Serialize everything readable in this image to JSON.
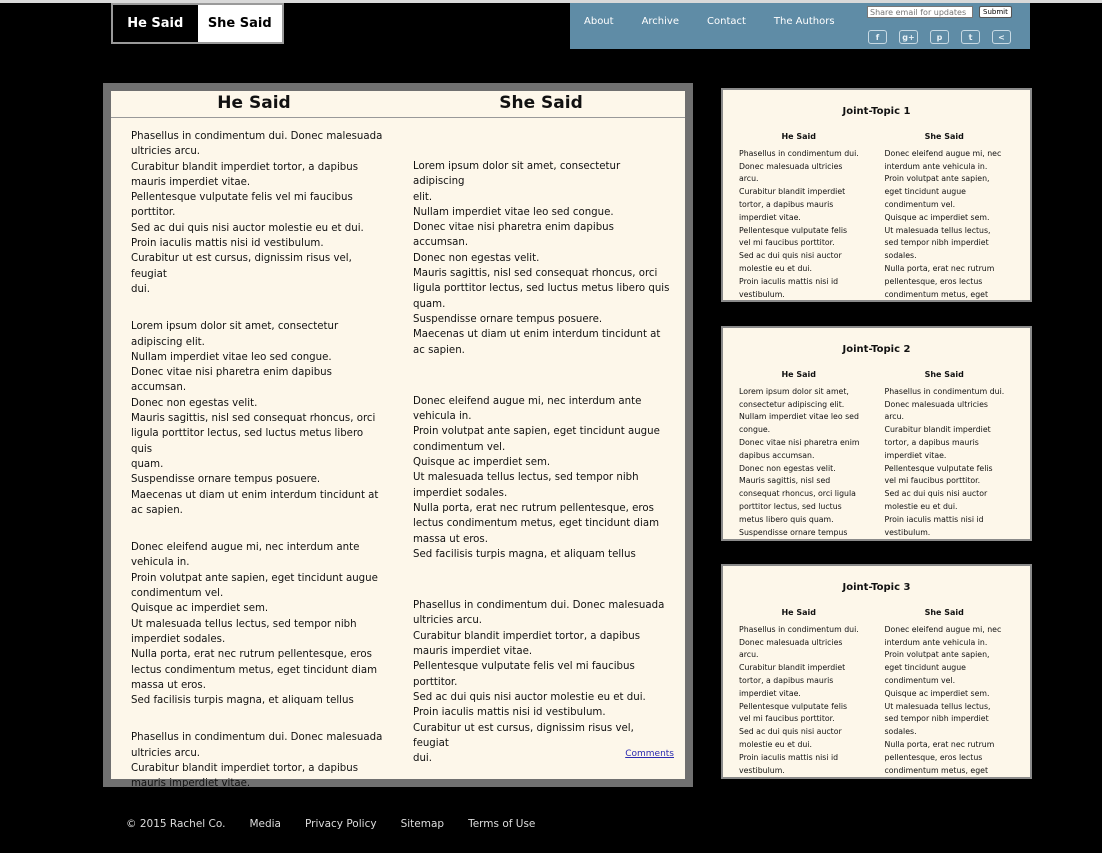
{
  "logo": {
    "he": "He Said",
    "she": "She Said"
  },
  "nav": {
    "links": [
      "About",
      "Archive",
      "Contact",
      "The Authors"
    ],
    "email_placeholder": "Share email for updates",
    "submit_label": "Submit",
    "social_icons": [
      "facebook-icon",
      "google-plus-icon",
      "pinterest-icon",
      "twitter-icon",
      "share-icon"
    ],
    "social_glyphs": [
      "f",
      "g+",
      "p",
      "t",
      "<"
    ]
  },
  "main": {
    "he_title": "He Said",
    "she_title": "She Said",
    "he_paragraphs": [
      [
        "Phasellus in condimentum dui. Donec malesuada",
        "ultricies arcu.",
        "Curabitur blandit imperdiet tortor, a dapibus",
        "mauris imperdiet vitae.",
        "Pellentesque vulputate felis vel mi faucibus",
        "porttitor.",
        "Sed ac dui quis nisi auctor molestie eu et dui.",
        "Proin iaculis mattis nisi id vestibulum.",
        "Curabitur ut est cursus, dignissim risus vel, feugiat",
        "dui."
      ],
      [
        "Lorem ipsum dolor sit amet, consectetur",
        "adipiscing elit.",
        "Nullam imperdiet vitae leo sed congue.",
        "Donec vitae nisi pharetra enim dapibus accumsan.",
        "Donec non egestas velit.",
        "Mauris sagittis, nisl sed consequat rhoncus, orci",
        "ligula porttitor lectus, sed luctus metus libero quis",
        "quam.",
        "Suspendisse ornare tempus posuere.",
        "Maecenas ut diam ut enim interdum tincidunt at",
        "ac sapien."
      ],
      [
        "Donec eleifend augue mi, nec interdum ante",
        "vehicula in.",
        "Proin volutpat ante sapien, eget tincidunt augue",
        "condimentum vel.",
        "Quisque ac imperdiet sem.",
        "Ut malesuada tellus lectus, sed tempor nibh",
        "imperdiet sodales.",
        "Nulla porta, erat nec rutrum pellentesque, eros",
        "lectus condimentum metus, eget tincidunt diam",
        "massa ut eros.",
        "Sed facilisis turpis magna, et aliquam tellus"
      ],
      [
        "Phasellus in condimentum dui. Donec malesuada",
        "ultricies arcu.",
        "Curabitur blandit imperdiet tortor, a dapibus",
        "mauris imperdiet vitae."
      ]
    ],
    "she_paragraphs": [
      [
        "Lorem ipsum dolor sit amet, consectetur adipiscing",
        "elit.",
        "Nullam imperdiet vitae leo sed congue.",
        "Donec vitae nisi pharetra enim dapibus accumsan.",
        "Donec non egestas velit.",
        "Mauris sagittis, nisl sed consequat rhoncus, orci",
        "ligula porttitor lectus, sed luctus metus libero quis",
        "quam.",
        "Suspendisse ornare tempus posuere.",
        "Maecenas ut diam ut enim interdum tincidunt at",
        "ac sapien."
      ],
      [
        "Donec eleifend augue mi, nec interdum ante",
        "vehicula in.",
        "Proin volutpat ante sapien, eget tincidunt augue",
        "condimentum vel.",
        "Quisque ac imperdiet sem.",
        "Ut malesuada tellus lectus, sed tempor nibh",
        "imperdiet sodales.",
        "Nulla porta, erat nec rutrum pellentesque, eros",
        "lectus condimentum metus, eget tincidunt diam",
        "massa ut eros.",
        "Sed facilisis turpis magna, et aliquam tellus"
      ],
      [
        "Phasellus in condimentum dui. Donec malesuada",
        "ultricies arcu.",
        "Curabitur blandit imperdiet tortor, a dapibus",
        "mauris imperdiet vitae.",
        "Pellentesque vulputate felis vel mi faucibus",
        "porttitor.",
        "Sed ac dui quis nisi auctor molestie eu et dui.",
        "Proin iaculis mattis nisi id vestibulum.",
        "Curabitur ut est cursus, dignissim risus vel, feugiat",
        "dui."
      ]
    ],
    "comments_label": "Comments"
  },
  "cards": [
    {
      "title": "Joint-Topic 1",
      "he_label": "He Said",
      "she_label": "She Said",
      "he_lines": [
        "Phasellus in condimentum dui.",
        "Donec malesuada ultricies",
        "arcu.",
        "Curabitur blandit imperdiet",
        "tortor, a dapibus mauris",
        "imperdiet vitae.",
        "Pellentesque vulputate felis",
        "vel mi faucibus porttitor.",
        "Sed ac dui quis nisi auctor",
        "molestie eu et dui.",
        "Proin iaculis mattis nisi id",
        "vestibulum."
      ],
      "she_lines": [
        "Donec eleifend augue mi, nec",
        "interdum ante vehicula in.",
        "Proin volutpat ante sapien,",
        "eget tincidunt augue",
        "condimentum vel.",
        "Quisque ac imperdiet sem.",
        "Ut malesuada tellus lectus,",
        "sed tempor nibh imperdiet",
        "sodales.",
        "Nulla porta, erat nec rutrum",
        "pellentesque, eros lectus",
        "condimentum metus, eget"
      ]
    },
    {
      "title": "Joint-Topic 2",
      "he_label": "He Said",
      "she_label": "She Said",
      "he_lines": [
        "Lorem ipsum dolor sit amet,",
        "consectetur adipiscing elit.",
        "Nullam imperdiet vitae leo sed",
        "congue.",
        "Donec vitae nisi pharetra enim",
        "dapibus accumsan.",
        "Donec non egestas velit.",
        "Mauris sagittis, nisl sed",
        "consequat rhoncus, orci ligula",
        "porttitor lectus, sed luctus",
        "metus libero quis quam.",
        "Suspendisse ornare tempus"
      ],
      "she_lines": [
        "Phasellus in condimentum dui.",
        "Donec malesuada ultricies",
        "arcu.",
        "Curabitur blandit imperdiet",
        "tortor, a dapibus mauris",
        "imperdiet vitae.",
        "Pellentesque vulputate felis",
        "vel mi faucibus porttitor.",
        "Sed ac dui quis nisi auctor",
        "molestie eu et dui.",
        "Proin iaculis mattis nisi id",
        "vestibulum."
      ]
    },
    {
      "title": "Joint-Topic 3",
      "he_label": "He Said",
      "she_label": "She Said",
      "he_lines": [
        "Phasellus in condimentum dui.",
        "Donec malesuada ultricies",
        "arcu.",
        "Curabitur blandit imperdiet",
        "tortor, a dapibus mauris",
        "imperdiet vitae.",
        "Pellentesque vulputate felis",
        "vel mi faucibus porttitor.",
        "Sed ac dui quis nisi auctor",
        "molestie eu et dui.",
        "Proin iaculis mattis nisi id",
        "vestibulum."
      ],
      "she_lines": [
        "Donec eleifend augue mi, nec",
        "interdum ante vehicula in.",
        "Proin volutpat ante sapien,",
        "eget tincidunt augue",
        "condimentum vel.",
        "Quisque ac imperdiet sem.",
        "Ut malesuada tellus lectus,",
        "sed tempor nibh imperdiet",
        "sodales.",
        "Nulla porta, erat nec rutrum",
        "pellentesque, eros lectus",
        "condimentum metus, eget"
      ]
    }
  ],
  "footer": {
    "copyright": "© 2015 Rachel Co.",
    "links": [
      "Media",
      "Privacy Policy",
      "Sitemap",
      "Terms of Use"
    ]
  },
  "colors": {
    "nav_bg": "#5f8ca6",
    "panel_bg": "#fdf7ea",
    "page_bg": "#000000"
  }
}
